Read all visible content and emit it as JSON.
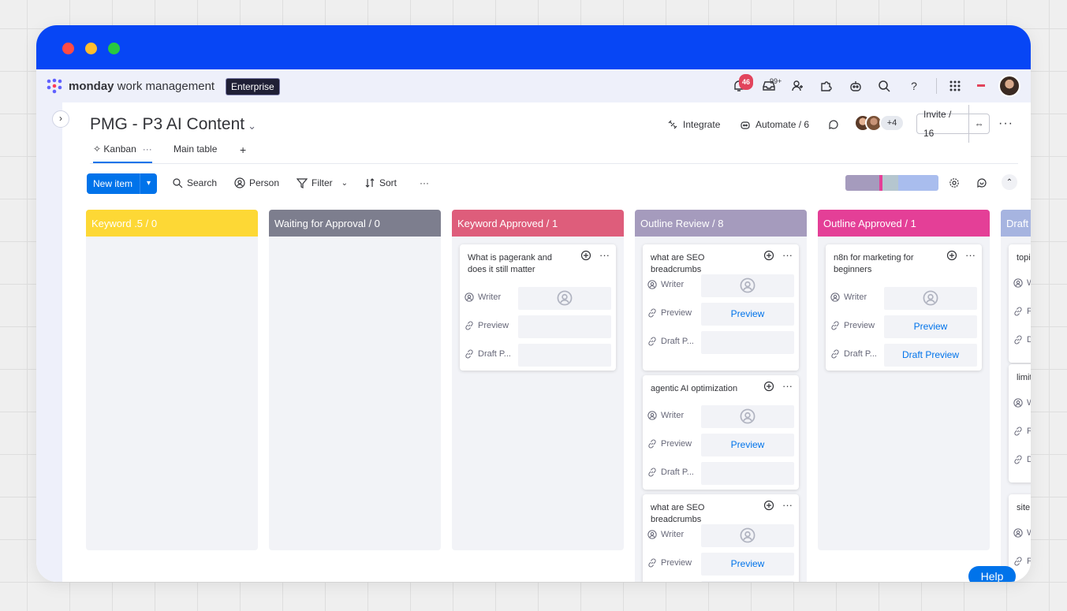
{
  "app": {
    "brand_bold": "monday",
    "brand_rest": " work management",
    "plan_badge": "Enterprise",
    "notifications_count": "46",
    "inbox_count": "99+"
  },
  "board": {
    "title": "PMG - P3 AI Content",
    "actions": {
      "integrate": "Integrate",
      "automate": "Automate / 6"
    },
    "members_extra": "+4",
    "invite": "Invite / 16"
  },
  "tabs": [
    {
      "label": "Kanban"
    },
    {
      "label": "Main table"
    }
  ],
  "toolbar": {
    "new_item": "New item",
    "search": "Search",
    "person": "Person",
    "filter": "Filter",
    "sort": "Sort"
  },
  "colors": {
    "accent": "#0073ea",
    "window_bar": "#0746f5"
  },
  "columns": [
    {
      "title": "Keyword .5 / 0",
      "color": "#fdd835",
      "cards": []
    },
    {
      "title": "Waiting for Approval / 0",
      "color": "#7d7e8e",
      "cards": []
    },
    {
      "title": "Keyword Approved / 1",
      "color": "#de5d7b",
      "cards": [
        {
          "title": "What is pagerank and does it still matter",
          "writer": "",
          "preview": "",
          "draft": ""
        }
      ]
    },
    {
      "title": "Outline Review / 8",
      "color": "#a59bbd",
      "cards": [
        {
          "title": "what are SEO breadcrumbs",
          "writer": "",
          "preview": "Preview",
          "draft": ""
        },
        {
          "title": "agentic AI optimization",
          "writer": "",
          "preview": "Preview",
          "draft": ""
        },
        {
          "title": "what are SEO breadcrumbs",
          "writer": "",
          "preview": "Preview",
          "draft": ""
        }
      ]
    },
    {
      "title": "Outline Approved / 1",
      "color": "#e43f97",
      "cards": [
        {
          "title": "n8n for marketing for beginners",
          "writer": "",
          "preview": "Preview",
          "draft": "Draft Preview"
        }
      ]
    },
    {
      "title": "Draft",
      "color": "#a6b4e0",
      "cards": [
        {
          "title": "topi",
          "writer": "",
          "preview": "",
          "draft": ""
        },
        {
          "title": "limit SEO",
          "writer": "",
          "preview": "",
          "draft": ""
        },
        {
          "title": "site",
          "writer": "",
          "preview": "",
          "draft": ""
        }
      ]
    }
  ],
  "field_labels": {
    "writer": "Writer",
    "preview": "Preview",
    "draft": "Draft P..."
  },
  "help": "Help"
}
